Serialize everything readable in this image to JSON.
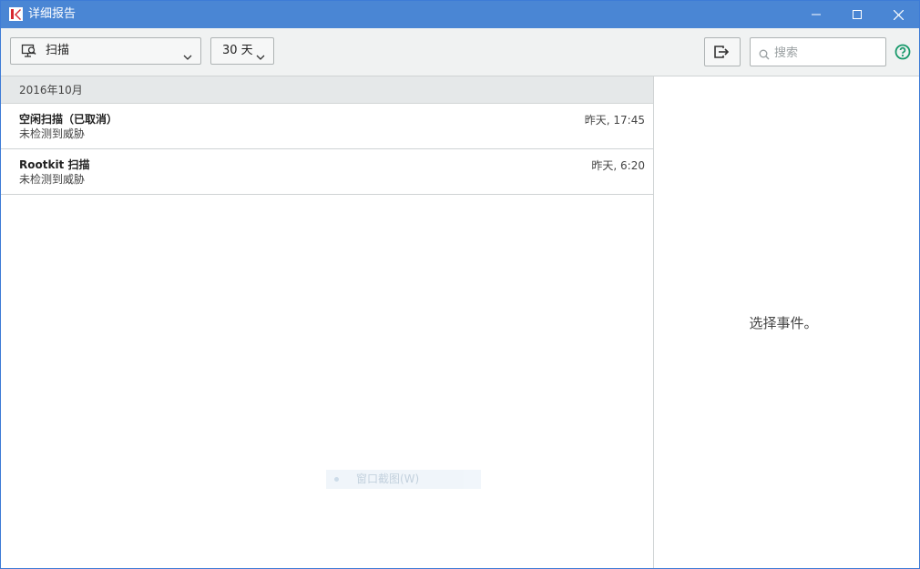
{
  "window": {
    "title": "详细报告",
    "title_bar_color": "#4a86d4"
  },
  "toolbar": {
    "report_type": {
      "selected": "扫描",
      "icon": "monitor-scan-icon"
    },
    "period": {
      "selected": "30 天"
    },
    "export_icon": "export-icon",
    "search": {
      "placeholder": "搜索",
      "value": ""
    },
    "help_icon": "help-icon",
    "accent_color": "#1a9a6c"
  },
  "list": {
    "group_label": "2016年10月",
    "items": [
      {
        "title": "空闲扫描（已取消）",
        "subtitle": "未检测到威胁",
        "time": "昨天, 17:45"
      },
      {
        "title": "Rootkit 扫描",
        "subtitle": "未检测到威胁",
        "time": "昨天, 6:20"
      }
    ]
  },
  "overlay": {
    "context_menu_item": "窗口截图(W)"
  },
  "detail": {
    "empty_hint": "选择事件。"
  }
}
